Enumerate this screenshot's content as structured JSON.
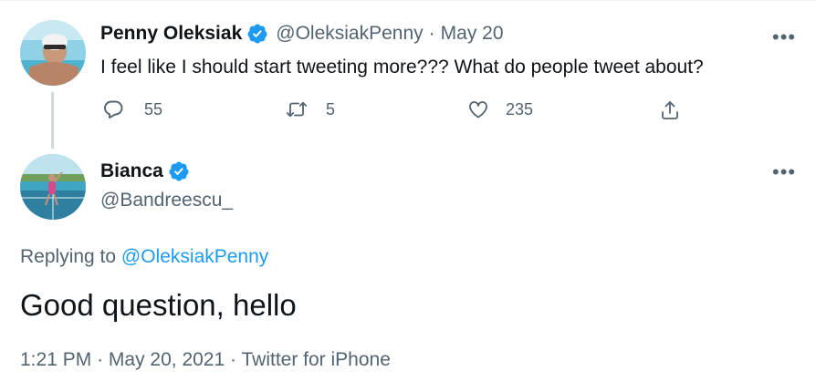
{
  "parent_tweet": {
    "author_name": "Penny Oleksiak",
    "handle": "@OleksiakPenny",
    "separator": "·",
    "date": "May 20",
    "text": "I feel like I should start tweeting more??? What do people tweet about?",
    "reply_count": "55",
    "retweet_count": "5",
    "like_count": "235",
    "more_label": "•••"
  },
  "main_tweet": {
    "author_name": "Bianca",
    "handle": "@Bandreescu_",
    "more_label": "•••",
    "replying_prefix": "Replying to",
    "replying_to": "@OleksiakPenny",
    "text": "Good question, hello",
    "time": "1:21 PM",
    "separator": "·",
    "date": "May 20, 2021",
    "separator2": "·",
    "source": "Twitter for iPhone"
  },
  "colors": {
    "verified": "#1d9bf0",
    "link": "#1d9bf0",
    "secondary_text": "#536471",
    "primary_text": "#0f1419"
  },
  "icons": [
    "verified-badge-icon",
    "reply-icon",
    "retweet-icon",
    "like-icon",
    "share-icon",
    "more-icon"
  ]
}
